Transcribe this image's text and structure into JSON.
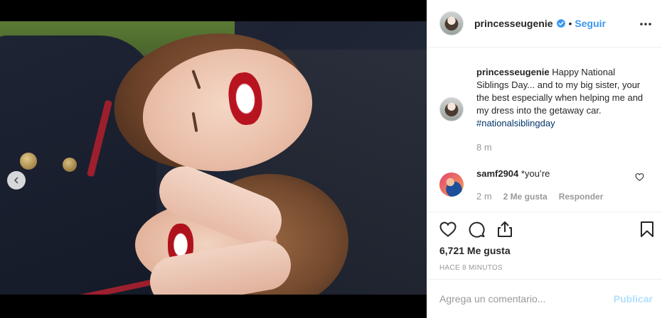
{
  "post": {
    "username": "princesseugenie",
    "follow_label": "Seguir",
    "separator": "•"
  },
  "caption": {
    "username": "princesseugenie",
    "text": "Happy National Siblings Day... and to my big sister, your the best especially when helping me and my dress into the getaway car.",
    "hashtag": "#nationalsiblingday",
    "time": "8 m"
  },
  "comment": {
    "username": "samf2904",
    "text": "*you’re",
    "time": "2 m",
    "likes": "2 Me gusta",
    "reply": "Responder"
  },
  "actions": {
    "likes_count": "6,721 Me gusta",
    "posted_ago": "HACE 8 MINUTOS"
  },
  "add_comment": {
    "placeholder": "Agrega un comentario...",
    "publish_label": "Publicar"
  },
  "carousel": {
    "total_slides": 2,
    "active_slide": 2
  },
  "colors": {
    "link_blue": "#3897f0",
    "publish_disabled": "#b2dffc",
    "muted": "#999999",
    "hashtag": "#003569"
  }
}
